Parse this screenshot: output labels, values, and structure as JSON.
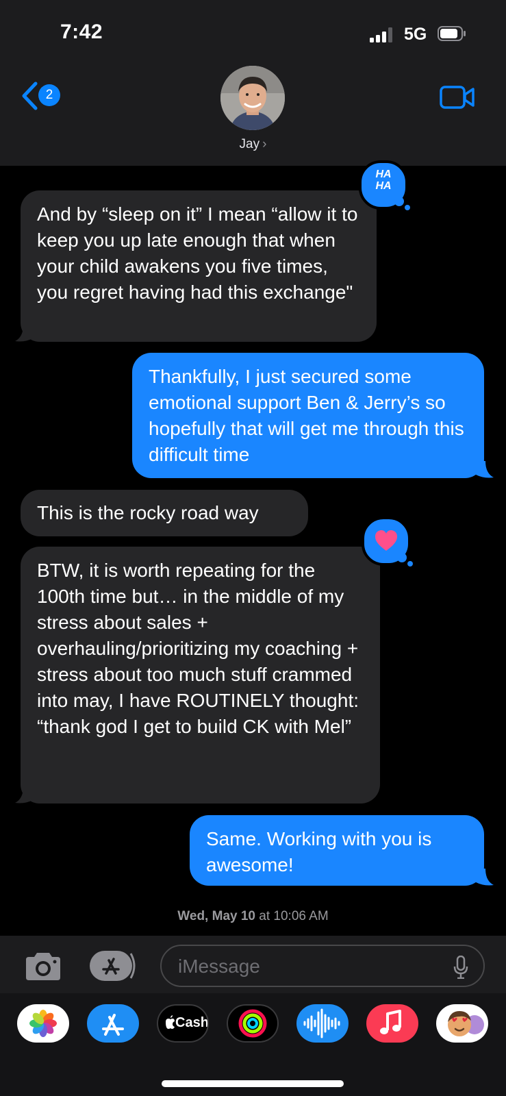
{
  "status_bar": {
    "time": "7:42",
    "network": "5G"
  },
  "nav": {
    "back_count": "2",
    "contact_name": "Jay",
    "contact_chevron": "›"
  },
  "messages": [
    {
      "direction": "incoming",
      "text": "And by “sleep on it” I mean “allow it to keep you up late enough that when your child awakens you five times, you regret having had this exchange\"",
      "reaction": "haha"
    },
    {
      "direction": "outgoing",
      "text": "Thankfully, I just secured some emotional support Ben & Jerry’s so hopefully that will get me through this difficult time"
    },
    {
      "direction": "incoming",
      "text": "This is the rocky road way"
    },
    {
      "direction": "incoming",
      "text": "BTW, it is worth repeating for the 100th time but… in the middle of my stress about sales + overhauling/prioritizing my coaching + stress about too much stuff crammed into may, I have ROUTINELY thought: “thank god I get to build CK with Mel”",
      "reaction": "heart"
    },
    {
      "direction": "outgoing",
      "text": "Same. Working with you is awesome!"
    }
  ],
  "reactions": {
    "haha_line1": "HA",
    "haha_line2": "HA"
  },
  "timestamp": {
    "day": "Wed, May 10",
    "rest": " at 10:06 AM"
  },
  "composer": {
    "placeholder": "iMessage"
  },
  "drawer": {
    "apps": [
      "photos-app",
      "app-store-app",
      "apple-cash-app",
      "activity-app",
      "voice-memo-app",
      "music-app",
      "memoji-app"
    ],
    "cash_label": "Cash"
  },
  "colors": {
    "outgoing_bubble": "#1a86ff",
    "incoming_bubble": "#262628",
    "accent": "#0a84ff"
  }
}
